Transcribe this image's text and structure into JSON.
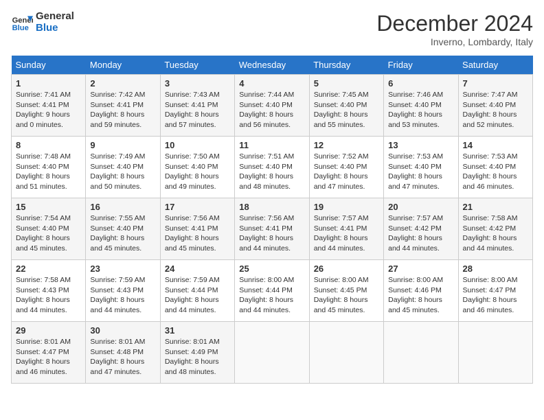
{
  "logo": {
    "line1": "General",
    "line2": "Blue"
  },
  "title": "December 2024",
  "subtitle": "Inverno, Lombardy, Italy",
  "weekdays": [
    "Sunday",
    "Monday",
    "Tuesday",
    "Wednesday",
    "Thursday",
    "Friday",
    "Saturday"
  ],
  "weeks": [
    [
      {
        "day": "1",
        "sunrise": "7:41 AM",
        "sunset": "4:41 PM",
        "daylight": "9 hours and 0 minutes."
      },
      {
        "day": "2",
        "sunrise": "7:42 AM",
        "sunset": "4:41 PM",
        "daylight": "8 hours and 59 minutes."
      },
      {
        "day": "3",
        "sunrise": "7:43 AM",
        "sunset": "4:41 PM",
        "daylight": "8 hours and 57 minutes."
      },
      {
        "day": "4",
        "sunrise": "7:44 AM",
        "sunset": "4:40 PM",
        "daylight": "8 hours and 56 minutes."
      },
      {
        "day": "5",
        "sunrise": "7:45 AM",
        "sunset": "4:40 PM",
        "daylight": "8 hours and 55 minutes."
      },
      {
        "day": "6",
        "sunrise": "7:46 AM",
        "sunset": "4:40 PM",
        "daylight": "8 hours and 53 minutes."
      },
      {
        "day": "7",
        "sunrise": "7:47 AM",
        "sunset": "4:40 PM",
        "daylight": "8 hours and 52 minutes."
      }
    ],
    [
      {
        "day": "8",
        "sunrise": "7:48 AM",
        "sunset": "4:40 PM",
        "daylight": "8 hours and 51 minutes."
      },
      {
        "day": "9",
        "sunrise": "7:49 AM",
        "sunset": "4:40 PM",
        "daylight": "8 hours and 50 minutes."
      },
      {
        "day": "10",
        "sunrise": "7:50 AM",
        "sunset": "4:40 PM",
        "daylight": "8 hours and 49 minutes."
      },
      {
        "day": "11",
        "sunrise": "7:51 AM",
        "sunset": "4:40 PM",
        "daylight": "8 hours and 48 minutes."
      },
      {
        "day": "12",
        "sunrise": "7:52 AM",
        "sunset": "4:40 PM",
        "daylight": "8 hours and 47 minutes."
      },
      {
        "day": "13",
        "sunrise": "7:53 AM",
        "sunset": "4:40 PM",
        "daylight": "8 hours and 47 minutes."
      },
      {
        "day": "14",
        "sunrise": "7:53 AM",
        "sunset": "4:40 PM",
        "daylight": "8 hours and 46 minutes."
      }
    ],
    [
      {
        "day": "15",
        "sunrise": "7:54 AM",
        "sunset": "4:40 PM",
        "daylight": "8 hours and 45 minutes."
      },
      {
        "day": "16",
        "sunrise": "7:55 AM",
        "sunset": "4:40 PM",
        "daylight": "8 hours and 45 minutes."
      },
      {
        "day": "17",
        "sunrise": "7:56 AM",
        "sunset": "4:41 PM",
        "daylight": "8 hours and 45 minutes."
      },
      {
        "day": "18",
        "sunrise": "7:56 AM",
        "sunset": "4:41 PM",
        "daylight": "8 hours and 44 minutes."
      },
      {
        "day": "19",
        "sunrise": "7:57 AM",
        "sunset": "4:41 PM",
        "daylight": "8 hours and 44 minutes."
      },
      {
        "day": "20",
        "sunrise": "7:57 AM",
        "sunset": "4:42 PM",
        "daylight": "8 hours and 44 minutes."
      },
      {
        "day": "21",
        "sunrise": "7:58 AM",
        "sunset": "4:42 PM",
        "daylight": "8 hours and 44 minutes."
      }
    ],
    [
      {
        "day": "22",
        "sunrise": "7:58 AM",
        "sunset": "4:43 PM",
        "daylight": "8 hours and 44 minutes."
      },
      {
        "day": "23",
        "sunrise": "7:59 AM",
        "sunset": "4:43 PM",
        "daylight": "8 hours and 44 minutes."
      },
      {
        "day": "24",
        "sunrise": "7:59 AM",
        "sunset": "4:44 PM",
        "daylight": "8 hours and 44 minutes."
      },
      {
        "day": "25",
        "sunrise": "8:00 AM",
        "sunset": "4:44 PM",
        "daylight": "8 hours and 44 minutes."
      },
      {
        "day": "26",
        "sunrise": "8:00 AM",
        "sunset": "4:45 PM",
        "daylight": "8 hours and 45 minutes."
      },
      {
        "day": "27",
        "sunrise": "8:00 AM",
        "sunset": "4:46 PM",
        "daylight": "8 hours and 45 minutes."
      },
      {
        "day": "28",
        "sunrise": "8:00 AM",
        "sunset": "4:47 PM",
        "daylight": "8 hours and 46 minutes."
      }
    ],
    [
      {
        "day": "29",
        "sunrise": "8:01 AM",
        "sunset": "4:47 PM",
        "daylight": "8 hours and 46 minutes."
      },
      {
        "day": "30",
        "sunrise": "8:01 AM",
        "sunset": "4:48 PM",
        "daylight": "8 hours and 47 minutes."
      },
      {
        "day": "31",
        "sunrise": "8:01 AM",
        "sunset": "4:49 PM",
        "daylight": "8 hours and 48 minutes."
      },
      null,
      null,
      null,
      null
    ]
  ]
}
